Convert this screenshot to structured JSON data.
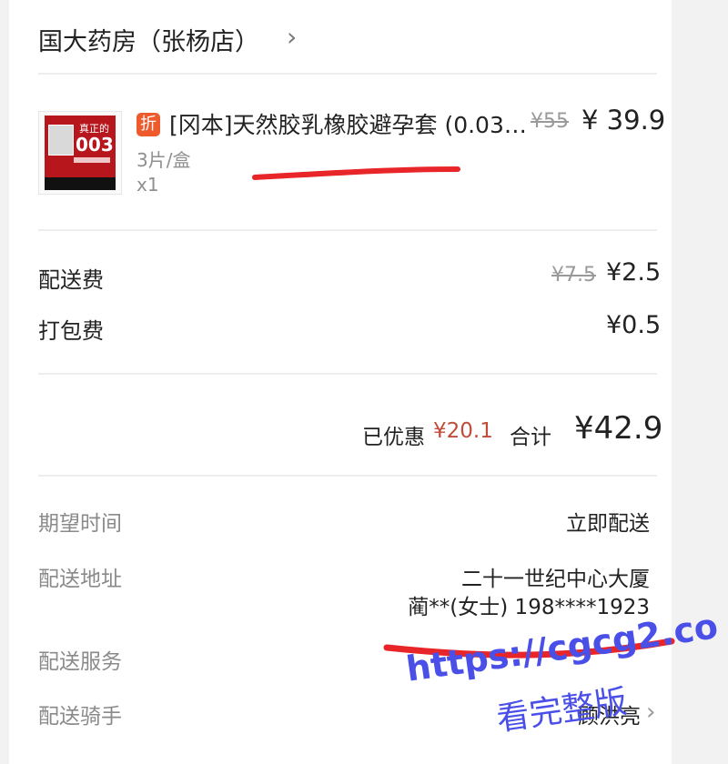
{
  "store": {
    "name": "国大药房（张杨店）"
  },
  "product": {
    "discount_tag": "折",
    "name": "[冈本]天然胶乳橡胶避孕套 (0.03…",
    "original_price": "¥55",
    "price": "¥ 39.9",
    "spec": "3片/盒",
    "quantity": "x1",
    "thumb_text_1": "真正的",
    "thumb_text_2": "003"
  },
  "fees": {
    "delivery": {
      "label": "配送费",
      "original": "¥7.5",
      "value": "¥2.5"
    },
    "packing": {
      "label": "打包费",
      "value": "¥0.5"
    }
  },
  "summary": {
    "saved_label": "已优惠",
    "saved_value": "¥20.1",
    "total_label": "合计",
    "total_value": "¥42.9"
  },
  "info": {
    "expected_time": {
      "label": "期望时间",
      "value": "立即配送"
    },
    "address": {
      "label": "配送地址",
      "line1": "二十一世纪中心大厦",
      "line2": "蔺**(女士) 198****1923"
    },
    "service": {
      "label": "配送服务"
    },
    "rider": {
      "label": "配送骑手",
      "value": "顾洪亮"
    }
  },
  "watermark": {
    "url": "https://cgcg2.co",
    "text": "看完整版"
  },
  "colors": {
    "discount_tag": "#ee5a2b",
    "saved": "#c04c3a",
    "scribble": "#e8262a",
    "watermark": "#4a4fe8"
  },
  "icons": {
    "store_chevron": "chevron-right-icon",
    "rider_chevron": "chevron-right-icon"
  }
}
